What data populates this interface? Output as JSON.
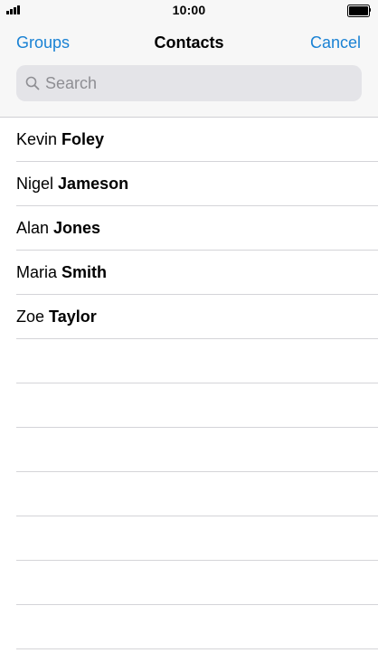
{
  "status_bar": {
    "time": "10:00"
  },
  "nav": {
    "left_label": "Groups",
    "title": "Contacts",
    "right_label": "Cancel"
  },
  "search": {
    "placeholder": "Search",
    "value": ""
  },
  "contacts": [
    {
      "first": "Kevin",
      "last": "Foley"
    },
    {
      "first": "Nigel",
      "last": "Jameson"
    },
    {
      "first": "Alan",
      "last": "Jones"
    },
    {
      "first": "Maria",
      "last": "Smith"
    },
    {
      "first": "Zoe",
      "last": "Taylor"
    }
  ],
  "colors": {
    "accent": "#1a82d4",
    "header_bg": "#f7f7f7",
    "search_bg": "#e4e4e8",
    "separator": "#d4d4d8"
  },
  "icons": {
    "signal": "cellular-signal-icon",
    "battery": "battery-icon",
    "search": "magnifying-glass-icon"
  }
}
